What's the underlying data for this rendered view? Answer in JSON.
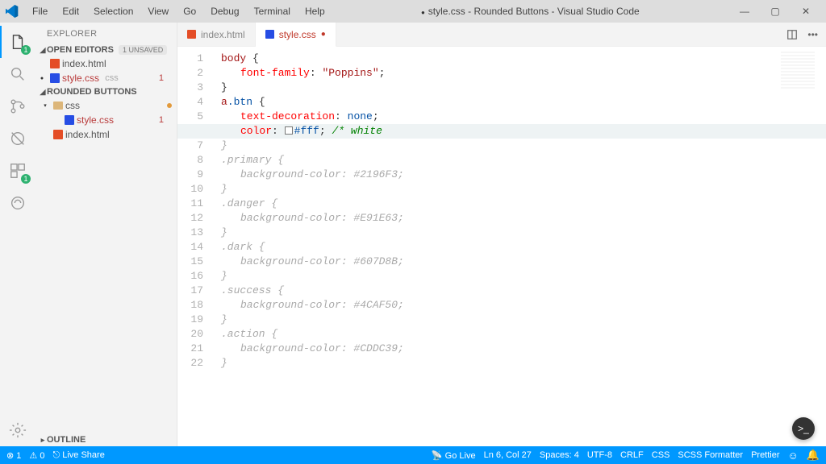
{
  "window": {
    "title": "style.css - Rounded Buttons - Visual Studio Code",
    "modified": true
  },
  "menu": [
    "File",
    "Edit",
    "Selection",
    "View",
    "Go",
    "Debug",
    "Terminal",
    "Help"
  ],
  "activity": {
    "badges": {
      "explorer": "1",
      "extensions": "1"
    }
  },
  "explorer": {
    "title": "EXPLORER",
    "open_editors": {
      "label": "OPEN EDITORS",
      "pill": "1 UNSAVED",
      "items": [
        {
          "name": "index.html",
          "icon": "html"
        },
        {
          "name": "style.css",
          "icon": "css",
          "suffix": "css",
          "modified": true,
          "error": true,
          "errors": "1"
        }
      ]
    },
    "workspace": {
      "label": "ROUNDED BUTTONS",
      "items": [
        {
          "name": "css",
          "icon": "folder",
          "expanded": true,
          "mod_dot": true
        },
        {
          "name": "style.css",
          "icon": "css",
          "indent": 1,
          "error": true,
          "errors": "1",
          "active": true
        },
        {
          "name": "index.html",
          "icon": "html"
        }
      ]
    },
    "outline": "OUTLINE"
  },
  "tabs": [
    {
      "label": "index.html",
      "icon": "html"
    },
    {
      "label": "style.css",
      "icon": "css",
      "active": true,
      "modified": true
    }
  ],
  "code": {
    "lines": [
      {
        "n": 1,
        "html": "<span class='tk-sel'>body</span> <span class='tk-br'>{</span>"
      },
      {
        "n": 2,
        "html": "<span class='indent'></span><span class='tk-prop'>font-family</span><span class='tk-br'>:</span> <span class='tk-str'>\"Poppins\"</span><span class='tk-br'>;</span>"
      },
      {
        "n": 3,
        "html": "<span class='tk-br'>}</span>"
      },
      {
        "n": 4,
        "html": "<span class='tk-sel'>a</span><span class='tk-cls'>.btn</span> <span class='tk-br'>{</span>"
      },
      {
        "n": 5,
        "html": "<span class='indent'></span><span class='tk-prop'>text-decoration</span><span class='tk-br'>:</span> <span class='tk-val'>none</span><span class='tk-br'>;</span>"
      },
      {
        "n": 6,
        "hl": true,
        "html": "<span class='indent'></span><span class='tk-prop'>color</span><span class='tk-br'>:</span> <span class='swatch' style='background:#fff;'></span><span class='tk-val'>#fff</span><span class='tk-br'>;</span> <span class='tk-cm'>/* white</span>"
      },
      {
        "n": 7,
        "html": "<span class='tk-dim'>}</span>"
      },
      {
        "n": 8,
        "html": "<span class='tk-dim'>.primary {</span>"
      },
      {
        "n": 9,
        "html": "<span class='indent'></span><span class='tk-dim'>background-color: #2196F3;</span>"
      },
      {
        "n": 10,
        "html": "<span class='tk-dim'>}</span>"
      },
      {
        "n": 11,
        "html": "<span class='tk-dim'>.danger {</span>"
      },
      {
        "n": 12,
        "html": "<span class='indent'></span><span class='tk-dim'>background-color: #E91E63;</span>"
      },
      {
        "n": 13,
        "html": "<span class='tk-dim'>}</span>"
      },
      {
        "n": 14,
        "html": "<span class='tk-dim'>.dark {</span>"
      },
      {
        "n": 15,
        "html": "<span class='indent'></span><span class='tk-dim'>background-color: #607D8B;</span>"
      },
      {
        "n": 16,
        "html": "<span class='tk-dim'>}</span>"
      },
      {
        "n": 17,
        "html": "<span class='tk-dim'>.success {</span>"
      },
      {
        "n": 18,
        "html": "<span class='indent'></span><span class='tk-dim'>background-color: #4CAF50;</span>"
      },
      {
        "n": 19,
        "html": "<span class='tk-dim'>}</span>"
      },
      {
        "n": 20,
        "html": "<span class='tk-dim'>.action {</span>"
      },
      {
        "n": 21,
        "html": "<span class='indent'></span><span class='tk-dim'>background-color: #CDDC39;</span>"
      },
      {
        "n": 22,
        "html": "<span class='tk-dim'>}</span>"
      }
    ]
  },
  "status": {
    "errors": "1",
    "warnings": "0",
    "liveshare": "Live Share",
    "golive": "Go Live",
    "cursor": "Ln 6, Col 27",
    "spaces": "Spaces: 4",
    "encoding": "UTF-8",
    "eol": "CRLF",
    "lang": "CSS",
    "formatter": "SCSS Formatter",
    "prettier": "Prettier"
  }
}
